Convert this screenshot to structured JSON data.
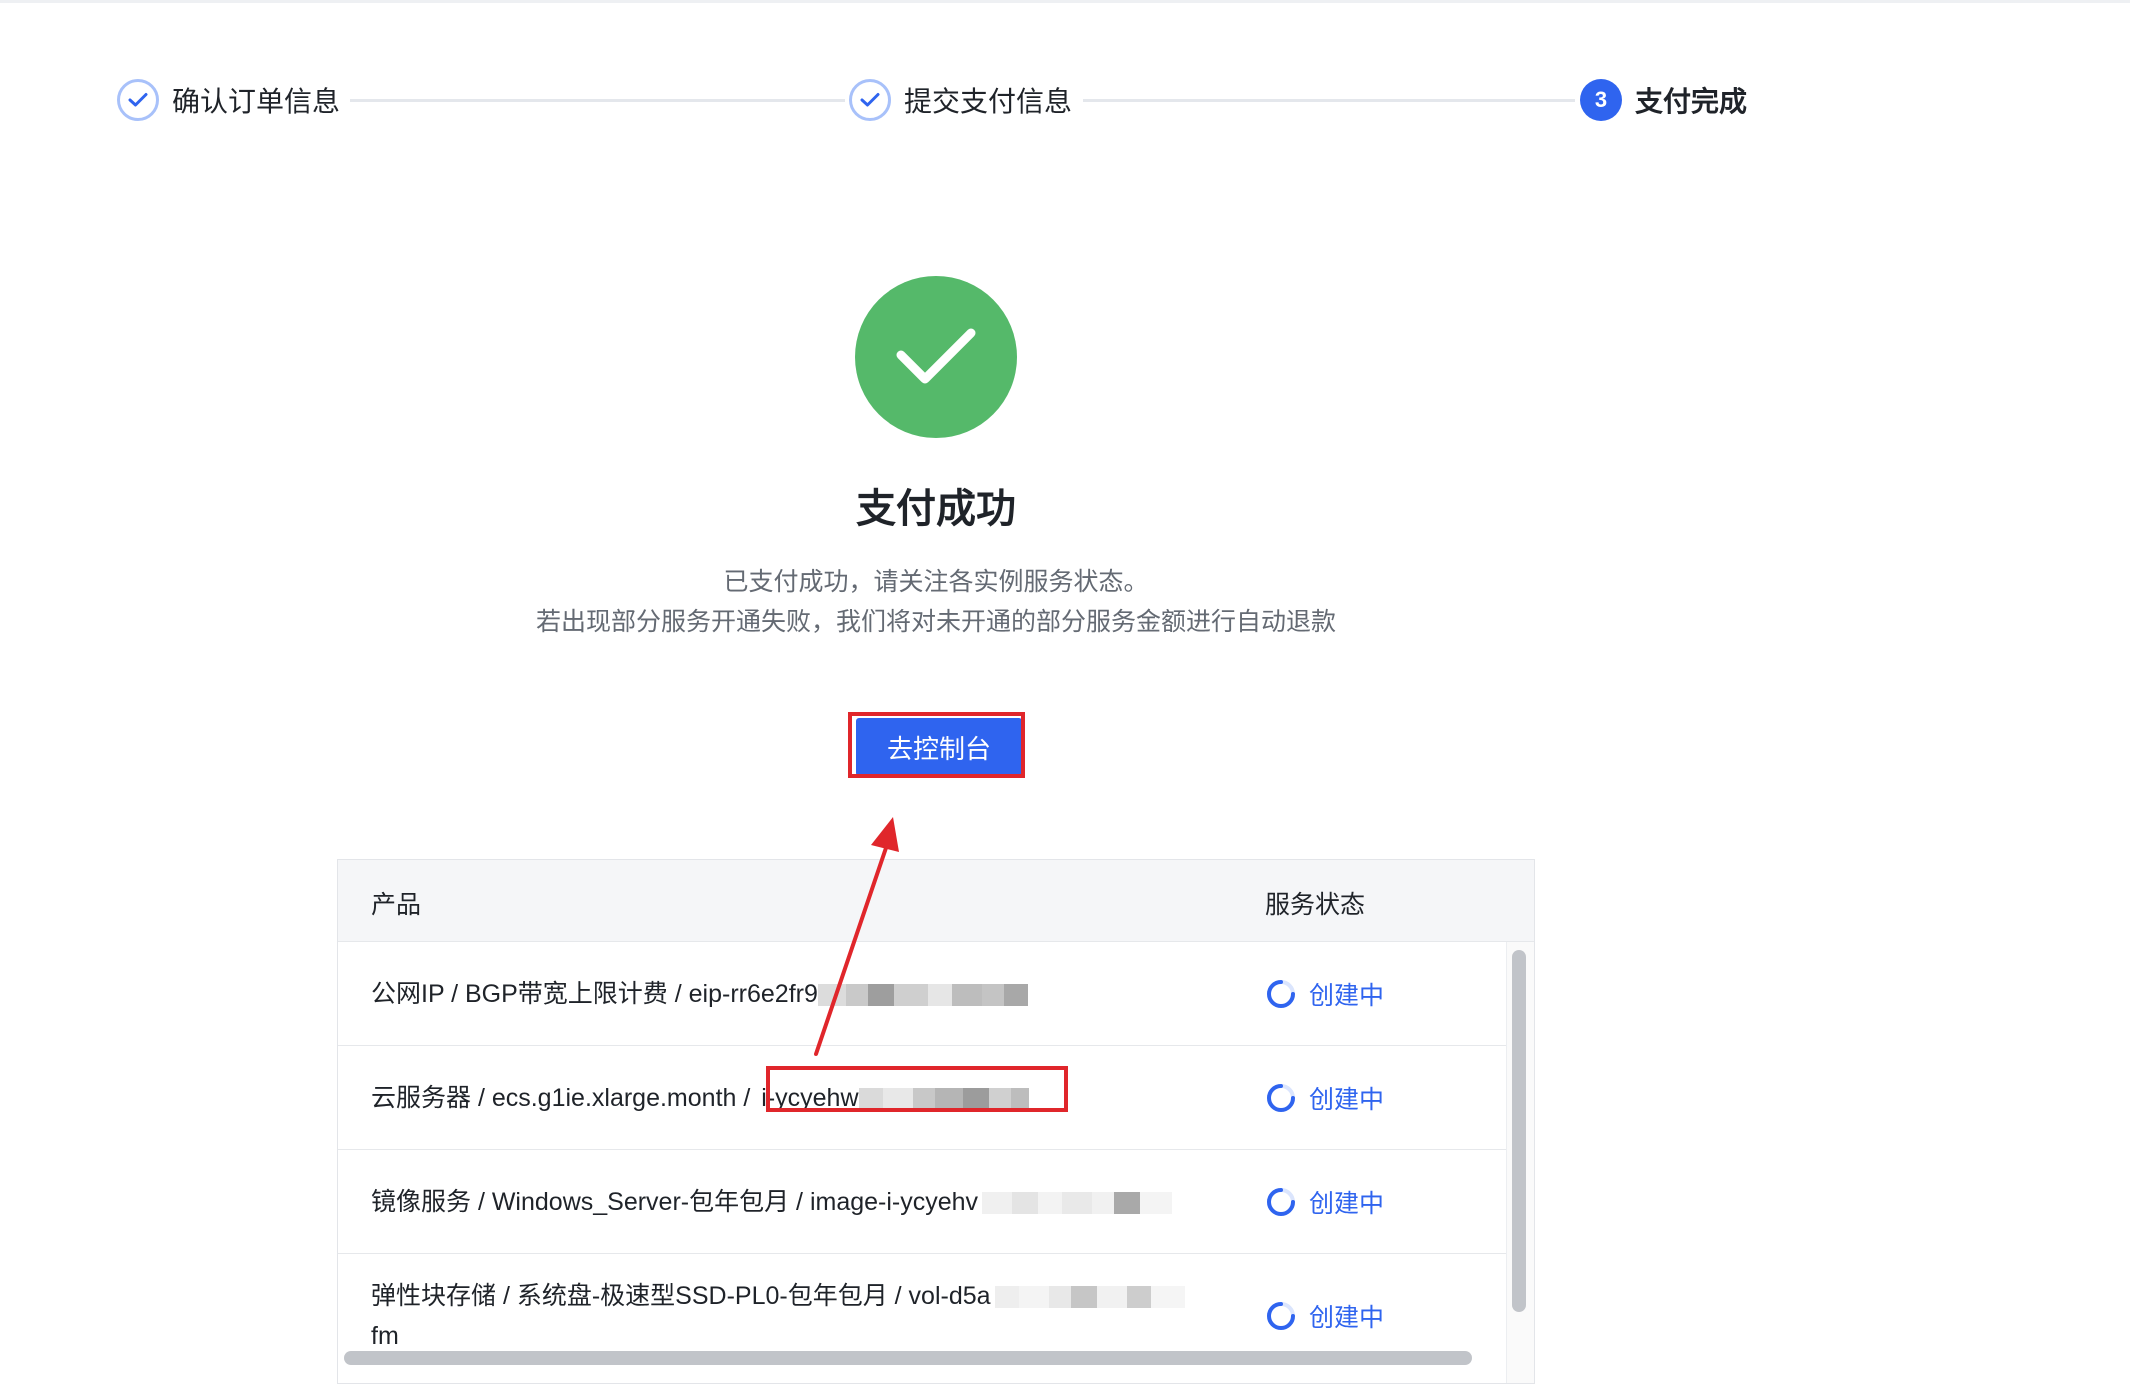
{
  "steps": [
    {
      "label": "确认订单信息",
      "state": "done"
    },
    {
      "label": "提交支付信息",
      "state": "done"
    },
    {
      "label": "支付完成",
      "state": "active",
      "number": "3"
    }
  ],
  "result": {
    "title": "支付成功",
    "desc_line1": "已支付成功，请关注各实例服务状态。",
    "desc_line2": "若出现部分服务开通失败，我们将对未开通的部分服务金额进行自动退款",
    "button": "去控制台"
  },
  "table": {
    "headers": {
      "product": "产品",
      "status": "服务状态"
    },
    "rows": [
      {
        "product": "公网IP / BGP带宽上限计费 / eip-rr6e2fr9",
        "status": "创建中"
      },
      {
        "product": "云服务器 / ecs.g1ie.xlarge.month / ",
        "product_id": "i-ycyehw",
        "status": "创建中"
      },
      {
        "product": "镜像服务 / Windows_Server-包年包月 / image-i-ycyehv",
        "status": "创建中"
      },
      {
        "product": "弹性块存储 / 系统盘-极速型SSD-PL0-包年包月 / vol-d5a",
        "product_line2": "fm",
        "status": "创建中"
      }
    ]
  },
  "colors": {
    "primary": "#2f64ef",
    "success": "#55b96a",
    "highlight": "#e0262b"
  }
}
